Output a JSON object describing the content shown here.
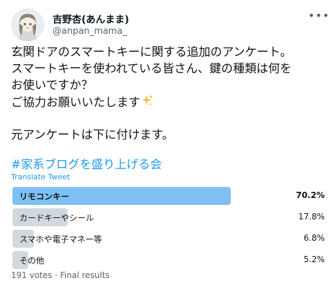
{
  "author": {
    "name": "吉野杏(あんまま)",
    "handle": "@anpan_mama_",
    "more_icon": "more-horizontal-icon"
  },
  "tweet": {
    "lines": [
      "玄関ドアのスマートキーに関する追加のアンケート。",
      "スマートキーを使われている皆さん、鍵の種類は何を",
      "お使いですか？",
      "ご協力お願いいたします"
    ],
    "sparkle_icon": "sparkles-icon",
    "line_after_gap": "元アンケートは下に付けます。",
    "hashtag": "#家系ブログを盛り上げる会",
    "translate_label": "Translate Tweet"
  },
  "poll": {
    "options": [
      {
        "label": "リモコンキー",
        "percent": 70.2,
        "percent_text": "70.2%",
        "winner": true
      },
      {
        "label": "カードキーやシール",
        "percent": 17.8,
        "percent_text": "17.8%",
        "winner": false
      },
      {
        "label": "スマホや電子マネー等",
        "percent": 6.8,
        "percent_text": "6.8%",
        "winner": false
      },
      {
        "label": "その他",
        "percent": 5.2,
        "percent_text": "5.2%",
        "winner": false
      }
    ],
    "votes_text": "191 votes",
    "separator": "·",
    "status_text": "Final results"
  },
  "colors": {
    "link": "#1d9bf0",
    "winner_bar": "#7fc1f2",
    "bar": "#cfd9de",
    "secondary_text": "#536471"
  }
}
